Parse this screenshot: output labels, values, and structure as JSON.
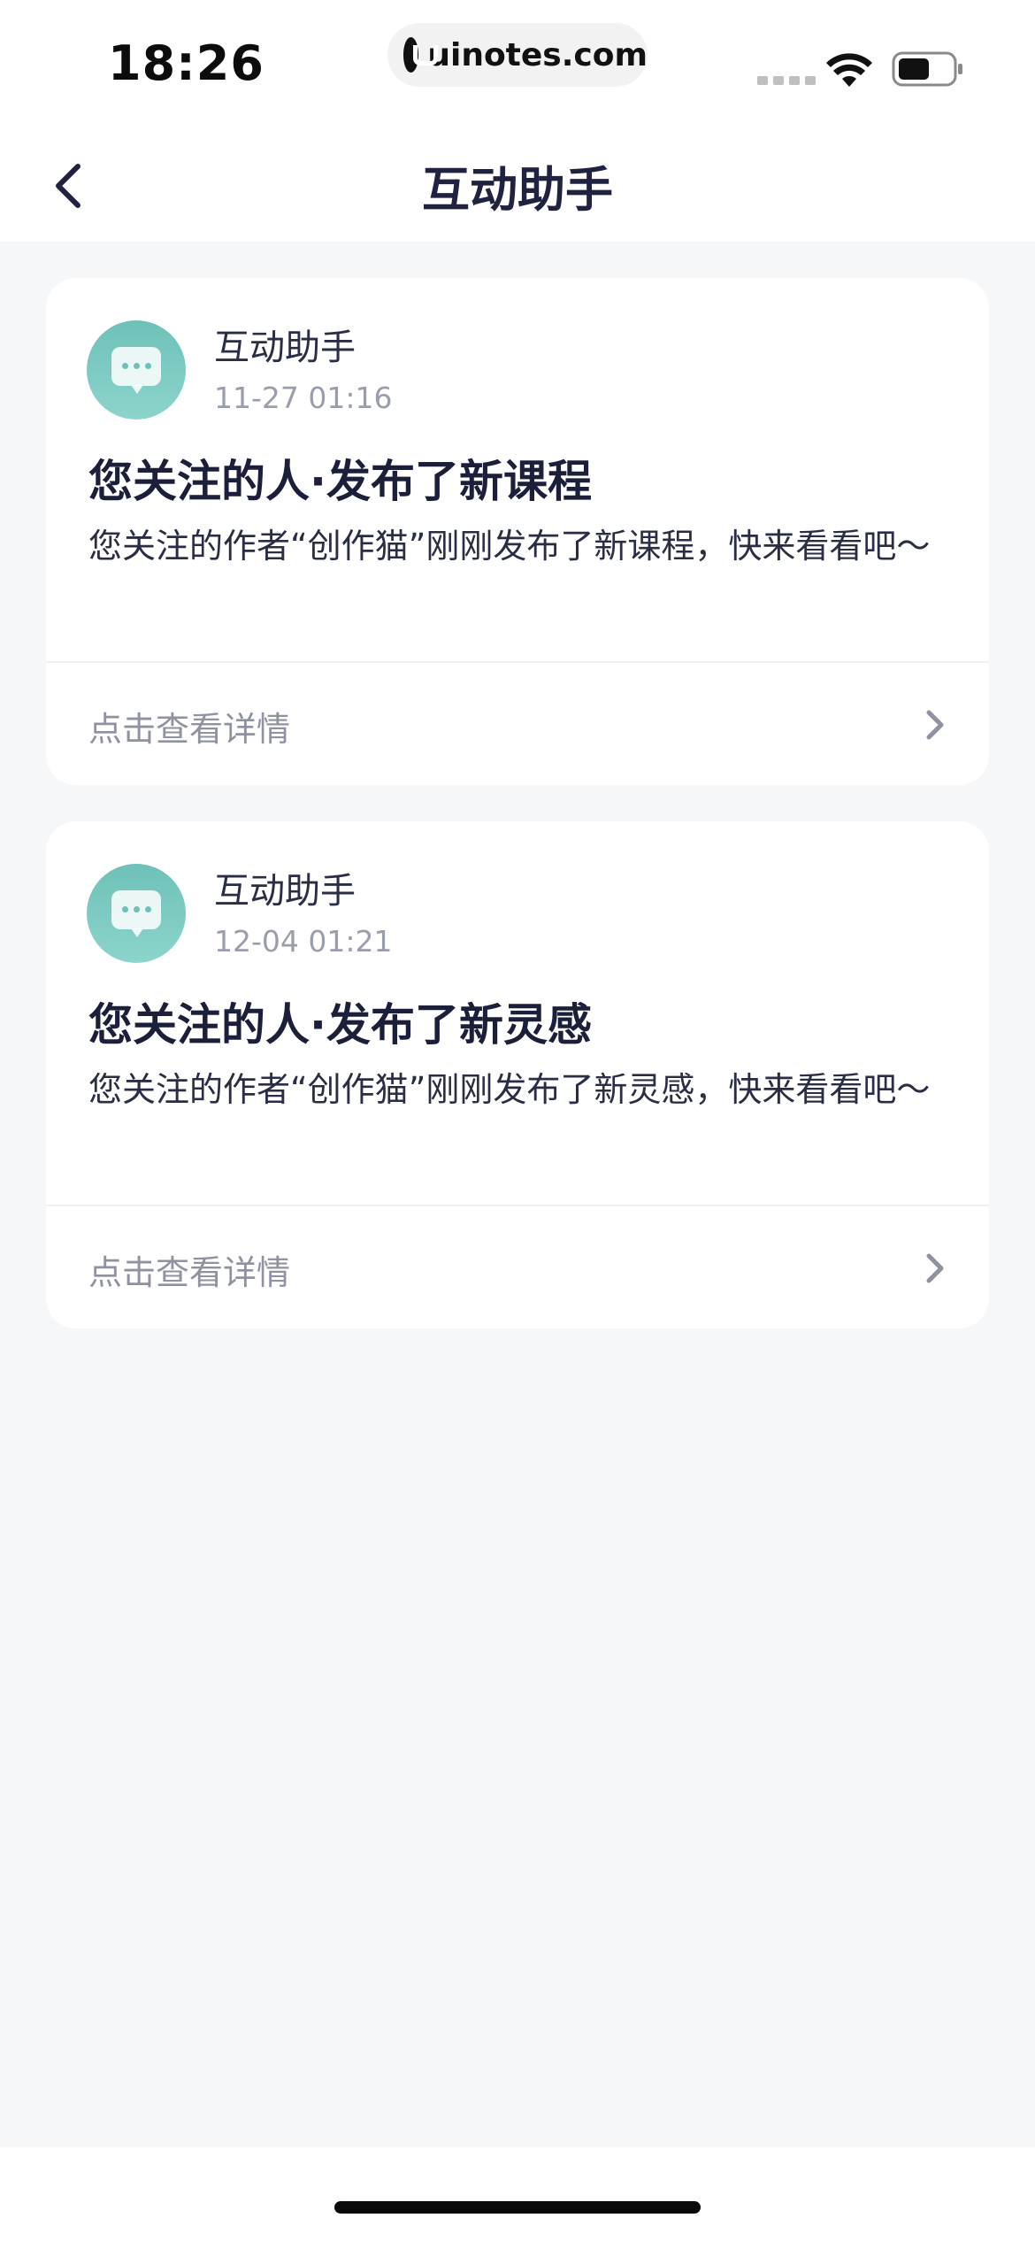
{
  "status_bar": {
    "time": "18:26",
    "url": "uinotes.com"
  },
  "nav": {
    "title": "互动助手"
  },
  "messages": [
    {
      "sender": "互动助手",
      "timestamp": "11-27 01:16",
      "title": "您关注的人·发布了新课程",
      "body": "您关注的作者“创作猫”刚刚发布了新课程，快来看看吧～",
      "action_label": "点击查看详情"
    },
    {
      "sender": "互动助手",
      "timestamp": "12-04 01:21",
      "title": "您关注的人·发布了新灵感",
      "body": "您关注的作者“创作猫”刚刚发布了新灵感，快来看看吧～",
      "action_label": "点击查看详情"
    }
  ],
  "colors": {
    "background": "#f6f7f9",
    "card": "#ffffff",
    "title_text": "#1c1f3a",
    "secondary_text": "#9a9dab",
    "avatar_gradient_top": "#6ec1b8",
    "avatar_gradient_bottom": "#8cd4cc"
  },
  "icons": {
    "back": "chevron-left-icon",
    "avatar": "chat-bubble-icon",
    "detail": "chevron-right-icon",
    "wifi": "wifi-icon",
    "battery": "battery-icon",
    "signal": "cellular-signal-icon"
  }
}
